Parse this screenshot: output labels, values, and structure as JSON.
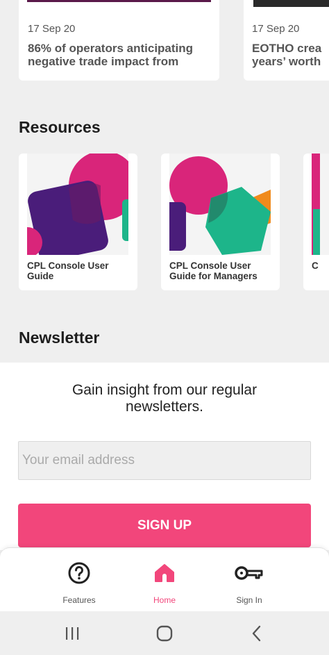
{
  "news": [
    {
      "date": "17 Sep 20",
      "title_line1": "86% of operators anticipating",
      "title_line2": "negative trade impact from"
    },
    {
      "date": "17 Sep 20",
      "title_line1": "EOTHO crea",
      "title_line2": "years’ worth"
    }
  ],
  "resources": {
    "heading": "Resources",
    "items": [
      {
        "label": "CPL Console User Guide"
      },
      {
        "label": "CPL Console User Guide for Managers"
      },
      {
        "label": "C"
      }
    ]
  },
  "newsletter": {
    "heading": "Newsletter",
    "text": "Gain insight from our regular newsletters.",
    "email_placeholder": "Your email address",
    "email_value": "",
    "signup_label": "SIGN UP"
  },
  "bottom_nav": {
    "items": [
      {
        "label": "Features",
        "icon": "help-circle-icon",
        "active": false
      },
      {
        "label": "Home",
        "icon": "home-icon",
        "active": true
      },
      {
        "label": "Sign In",
        "icon": "key-icon",
        "active": false
      }
    ]
  },
  "colors": {
    "accent": "#f2467b",
    "magenta": "#d9257a",
    "purple": "#4a1d7a",
    "green": "#1db58a",
    "orange": "#f08a1c"
  },
  "system_bar": {
    "buttons": [
      "recents-icon",
      "home-circle-icon",
      "back-icon"
    ]
  }
}
